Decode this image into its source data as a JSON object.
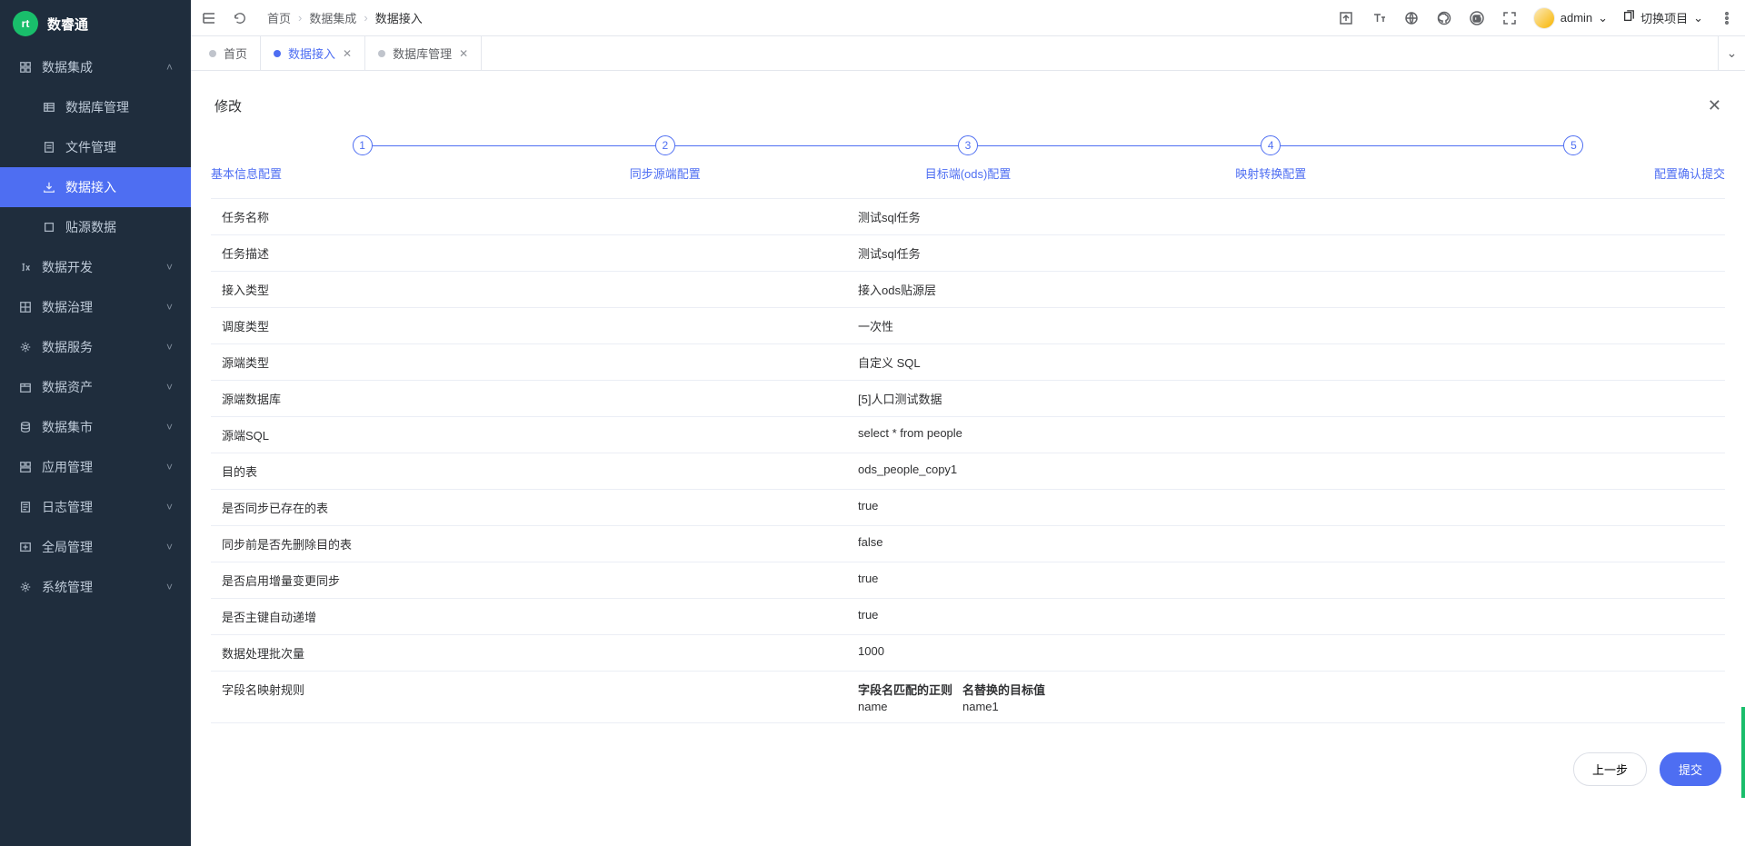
{
  "brand": "数睿通",
  "sidebar": {
    "items": [
      {
        "label": "数据集成",
        "icon": "grid",
        "expandable": true,
        "expanded": true
      },
      {
        "label": "数据库管理",
        "icon": "list",
        "sub": true
      },
      {
        "label": "文件管理",
        "icon": "file",
        "sub": true
      },
      {
        "label": "数据接入",
        "icon": "import",
        "sub": true,
        "active": true
      },
      {
        "label": "贴源数据",
        "icon": "square",
        "sub": true
      },
      {
        "label": "数据开发",
        "icon": "fx",
        "expandable": true
      },
      {
        "label": "数据治理",
        "icon": "grid2",
        "expandable": true
      },
      {
        "label": "数据服务",
        "icon": "gear",
        "expandable": true
      },
      {
        "label": "数据资产",
        "icon": "box",
        "expandable": true
      },
      {
        "label": "数据集市",
        "icon": "db",
        "expandable": true
      },
      {
        "label": "应用管理",
        "icon": "app",
        "expandable": true
      },
      {
        "label": "日志管理",
        "icon": "log",
        "expandable": true
      },
      {
        "label": "全局管理",
        "icon": "global",
        "expandable": true
      },
      {
        "label": "系统管理",
        "icon": "gear2",
        "expandable": true
      }
    ]
  },
  "breadcrumb": [
    "首页",
    "数据集成",
    "数据接入"
  ],
  "header": {
    "admin": "admin",
    "switchProject": "切换项目"
  },
  "tabs": [
    {
      "label": "首页",
      "closable": false
    },
    {
      "label": "数据接入",
      "closable": true,
      "active": true
    },
    {
      "label": "数据库管理",
      "closable": true
    }
  ],
  "page": {
    "title": "修改"
  },
  "steps": [
    {
      "num": "1",
      "title": "基本信息配置"
    },
    {
      "num": "2",
      "title": "同步源端配置"
    },
    {
      "num": "3",
      "title": "目标端(ods)配置"
    },
    {
      "num": "4",
      "title": "映射转换配置"
    },
    {
      "num": "5",
      "title": "配置确认提交"
    }
  ],
  "rows": [
    {
      "label": "任务名称",
      "value": "测试sql任务"
    },
    {
      "label": "任务描述",
      "value": "测试sql任务"
    },
    {
      "label": "接入类型",
      "value": "接入ods贴源层"
    },
    {
      "label": "调度类型",
      "value": "一次性"
    },
    {
      "label": "源端类型",
      "value": "自定义 SQL"
    },
    {
      "label": "源端数据库",
      "value": "[5]人口测试数据"
    },
    {
      "label": "源端SQL",
      "value": "select * from people"
    },
    {
      "label": "目的表",
      "value": "ods_people_copy1"
    },
    {
      "label": "是否同步已存在的表",
      "value": "true"
    },
    {
      "label": "同步前是否先删除目的表",
      "value": "false"
    },
    {
      "label": "是否启用增量变更同步",
      "value": "true"
    },
    {
      "label": "是否主键自动递增",
      "value": "true"
    },
    {
      "label": "数据处理批次量",
      "value": "1000"
    }
  ],
  "mapping": {
    "rowLabel": "字段名映射规则",
    "headers": [
      "字段名匹配的正则",
      "名替换的目标值"
    ],
    "data": [
      [
        "name",
        "name1"
      ]
    ]
  },
  "footer": {
    "prev": "上一步",
    "submit": "提交"
  }
}
